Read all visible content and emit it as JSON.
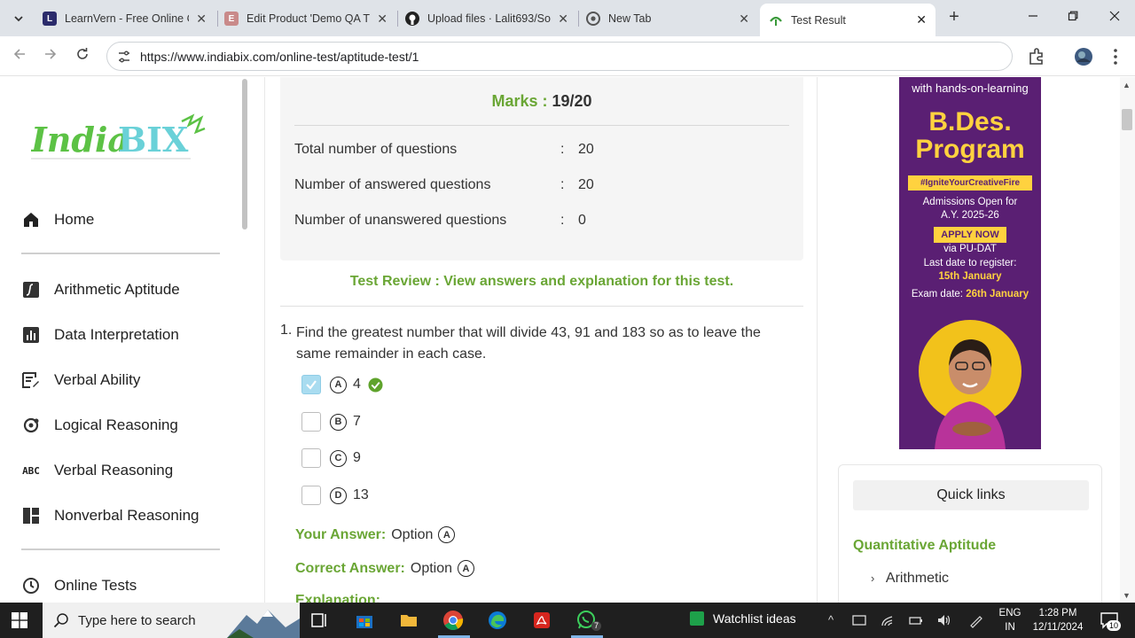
{
  "browser": {
    "tabs": [
      {
        "title": "LearnVern - Free Online C",
        "active": false
      },
      {
        "title": "Edit Product 'Demo QA T",
        "active": false
      },
      {
        "title": "Upload files · Lalit693/So",
        "active": false
      },
      {
        "title": "New Tab",
        "active": false
      },
      {
        "title": "Test Result",
        "active": true
      }
    ],
    "url": "https://www.indiabix.com/online-test/aptitude-test/1"
  },
  "sidebar": {
    "logo_text": "IndiaBIX",
    "home": "Home",
    "items": [
      {
        "label": "Arithmetic Aptitude",
        "icon": "function-icon"
      },
      {
        "label": "Data Interpretation",
        "icon": "bar-chart-icon"
      },
      {
        "label": "Verbal Ability",
        "icon": "document-edit-icon"
      },
      {
        "label": "Logical Reasoning",
        "icon": "logic-icon"
      },
      {
        "label": "Verbal Reasoning",
        "icon": "abc-icon"
      },
      {
        "label": "Nonverbal Reasoning",
        "icon": "dashboard-icon"
      }
    ],
    "online_tests": "Online Tests"
  },
  "result": {
    "marks_label": "Marks :",
    "marks_value": "19/20",
    "stats": [
      {
        "label": "Total number of questions",
        "sep": ":",
        "value": "20"
      },
      {
        "label": "Number of answered questions",
        "sep": ":",
        "value": "20"
      },
      {
        "label": "Number of unanswered questions",
        "sep": ":",
        "value": "0"
      }
    ],
    "review_text": "Test Review : View answers and explanation for this test."
  },
  "question": {
    "number": "1.",
    "text": "Find the greatest number that will divide 43, 91 and 183 so as to leave the same remainder in each case.",
    "options": [
      {
        "letter": "A",
        "value": "4",
        "checked": true,
        "correct": true
      },
      {
        "letter": "B",
        "value": "7",
        "checked": false,
        "correct": false
      },
      {
        "letter": "C",
        "value": "9",
        "checked": false,
        "correct": false
      },
      {
        "letter": "D",
        "value": "13",
        "checked": false,
        "correct": false
      }
    ],
    "your_answer_label": "Your Answer:",
    "your_answer_prefix": "Option",
    "your_answer_letter": "A",
    "correct_answer_label": "Correct Answer:",
    "correct_answer_prefix": "Option",
    "correct_answer_letter": "A",
    "explanation_label": "Explanation:"
  },
  "ad": {
    "top_text": "with hands-on-learning",
    "title_line1": "B.Des.",
    "title_line2": "Program",
    "tag": "#IgniteYourCreativeFire",
    "admissions_line1": "Admissions Open for",
    "admissions_line2": "A.Y. 2025-26",
    "button": "APPLY NOW",
    "via": "via PU-DAT",
    "register_line": "Last date to register:",
    "register_date": "15th January",
    "exam_label": "Exam date:",
    "exam_date": "26th January"
  },
  "quick_links": {
    "title": "Quick links",
    "section": "Quantitative Aptitude",
    "item": "Arithmetic"
  },
  "taskbar": {
    "search_placeholder": "Type here to search",
    "watchlist": "Watchlist ideas",
    "whatsapp_badge": "7",
    "lang_line1": "ENG",
    "lang_line2": "IN",
    "time": "1:28 PM",
    "date": "12/11/2024",
    "notif_count": "10"
  }
}
